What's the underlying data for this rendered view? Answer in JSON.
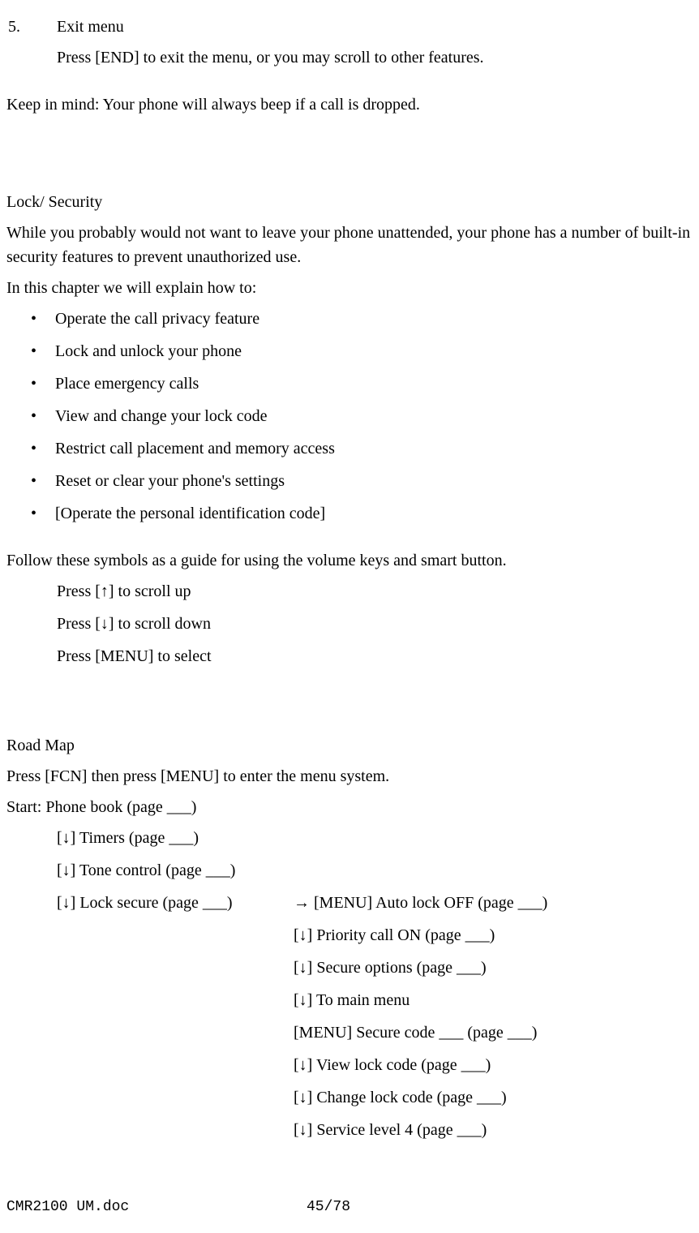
{
  "step5": {
    "number": "5.",
    "title": "Exit menu",
    "body": "Press [END] to exit the menu, or you may scroll to other features."
  },
  "keep_in_mind": "Keep in mind:  Your phone will always beep if a call is dropped.",
  "lock_security": {
    "heading": "Lock/ Security",
    "intro": "While you probably would not want to leave your phone unattended, your phone has a number of built-in security features to prevent unauthorized use.",
    "explain": "In this chapter we will explain how to:",
    "bullets": [
      "Operate the call privacy feature",
      "Lock and unlock your phone",
      "Place emergency calls",
      "View and change your lock code",
      "Restrict call placement and memory access",
      "Reset or clear your phone's settings",
      "[Operate the personal identification code]"
    ]
  },
  "symbols_guide": {
    "intro": "Follow these symbols as a guide for using the volume keys and smart button.",
    "lines": [
      "Press [↑] to scroll up",
      "Press [↓] to scroll down",
      "Press [MENU] to select"
    ]
  },
  "roadmap": {
    "heading": "Road Map",
    "instruction": "Press [FCN] then press [MENU] to enter the menu system.",
    "start": "Start: Phone book (page ___)",
    "left": [
      "[↓] Timers (page ___)",
      "[↓] Tone control (page ___)",
      "[↓] Lock secure (page ___)"
    ],
    "right": [
      "→ [MENU] Auto lock OFF (page ___)",
      "[↓] Priority call ON (page ___)",
      "[↓] Secure options (page ___)",
      "[↓] To main menu",
      "[MENU] Secure code ___ (page ___)",
      "[↓] View lock code (page ___)",
      "[↓] Change lock code (page ___)",
      "[↓] Service level 4 (page ___)"
    ]
  },
  "footer": {
    "filename": "CMR2100 UM.doc",
    "pagenum": "45/78"
  }
}
